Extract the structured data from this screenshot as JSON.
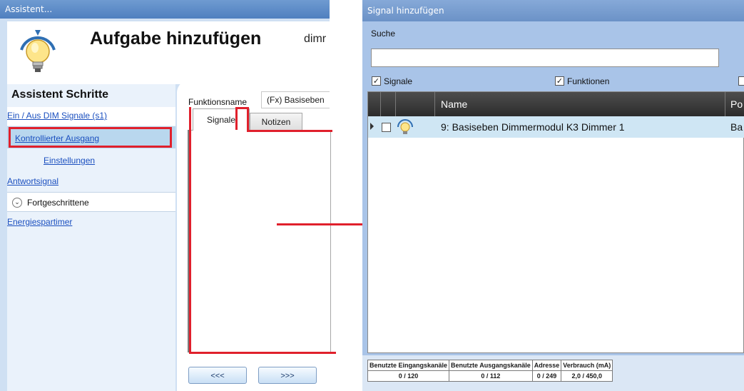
{
  "left_window": {
    "title": "Assistent...",
    "heading": "Aufgabe hinzufügen",
    "heading_sub": "dimr",
    "steps_title": "Assistent Schritte",
    "steps": [
      {
        "label": "Ein / Aus DIM Signale (s1)"
      },
      {
        "label": "Kontrollierter Ausgang"
      },
      {
        "label": "Einstellungen"
      },
      {
        "label": "Antwortsignal"
      },
      {
        "label": "Fortgeschrittene"
      },
      {
        "label": "Energiespartimer"
      }
    ],
    "function_name_label": "Funktionsname",
    "function_name_value": "(Fx) Basiseben",
    "tabs": [
      {
        "label": "Signale"
      },
      {
        "label": "Notizen"
      }
    ],
    "buttons": {
      "back": "<<<",
      "next": ">>>"
    }
  },
  "right_window": {
    "title": "Signal hinzufügen",
    "search_label": "Suche",
    "search_value": "",
    "filters": [
      {
        "label": "Signale",
        "checked": true
      },
      {
        "label": "Funktionen",
        "checked": true
      }
    ],
    "grid": {
      "columns": [
        "Name",
        "Po"
      ],
      "rows": [
        {
          "name": "9: Basiseben Dimmermodul K3 Dimmer 1",
          "pos": "Ba",
          "checked": false
        }
      ]
    },
    "status": {
      "headers": [
        "Benutzte Eingangskanäle",
        "Benutzte Ausgangskanäle",
        "Adresse",
        "Verbrauch (mA)"
      ],
      "values": [
        "0 / 120",
        "0 / 112",
        "0 / 249",
        "2,0 / 450,0"
      ]
    }
  },
  "colors": {
    "annotation_red": "#e0202c",
    "title_bar": "#5a87c4",
    "highlight_row": "#cfe6f4"
  }
}
